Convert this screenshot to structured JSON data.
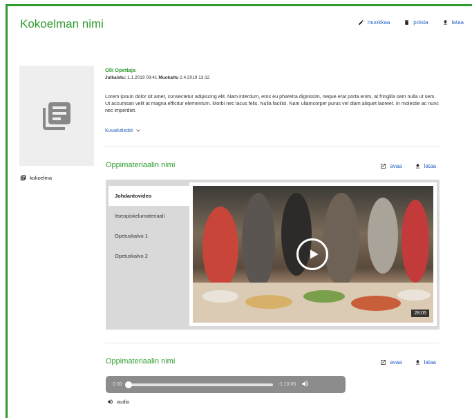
{
  "collection": {
    "title": "Kokoelman nimi",
    "actions": {
      "edit": "muokkaa",
      "delete": "poista",
      "download": "lataa"
    },
    "author": "Olli Opettaja",
    "published_label": "Julkaistu:",
    "published_value": "1.1.2019 09:41",
    "modified_label": "Muokattu",
    "modified_value": "2.4.2019 13:12",
    "description": "Lorem ipsum dolor sit amet, consectetur adipiscing elit. Nam interdum, eros eu pharetra dignissim, neque erat porta enim, at fringilla sem nulla ut sem. Ut accumsan velit at magna efficitur elementum. Morbi nec lacus felis. Nulla facilisi. Nam ullamcorper purus vel diam aliquet laoreet. In molestie ac nunc nec imperdiet.",
    "more_details": "Kuvailutiedot",
    "type_label": "kokoelma"
  },
  "material1": {
    "title": "Oppimateriaalin nimi",
    "open": "avaa",
    "download": "lataa",
    "playlist": [
      "Johdantovideo",
      "Itseopiskelumateriaali",
      "Opetuskalvo 1",
      "Opetuskalvo 2"
    ],
    "duration": "28:05"
  },
  "material2": {
    "title": "Oppimateriaalin nimi",
    "open": "avaa",
    "download": "lataa",
    "current_time": "0:00",
    "remaining_time": "-1:10:05",
    "progress": 0,
    "type_label": "audio"
  },
  "colors": {
    "accent": "#2e9b2e",
    "link": "#2a62c2"
  }
}
